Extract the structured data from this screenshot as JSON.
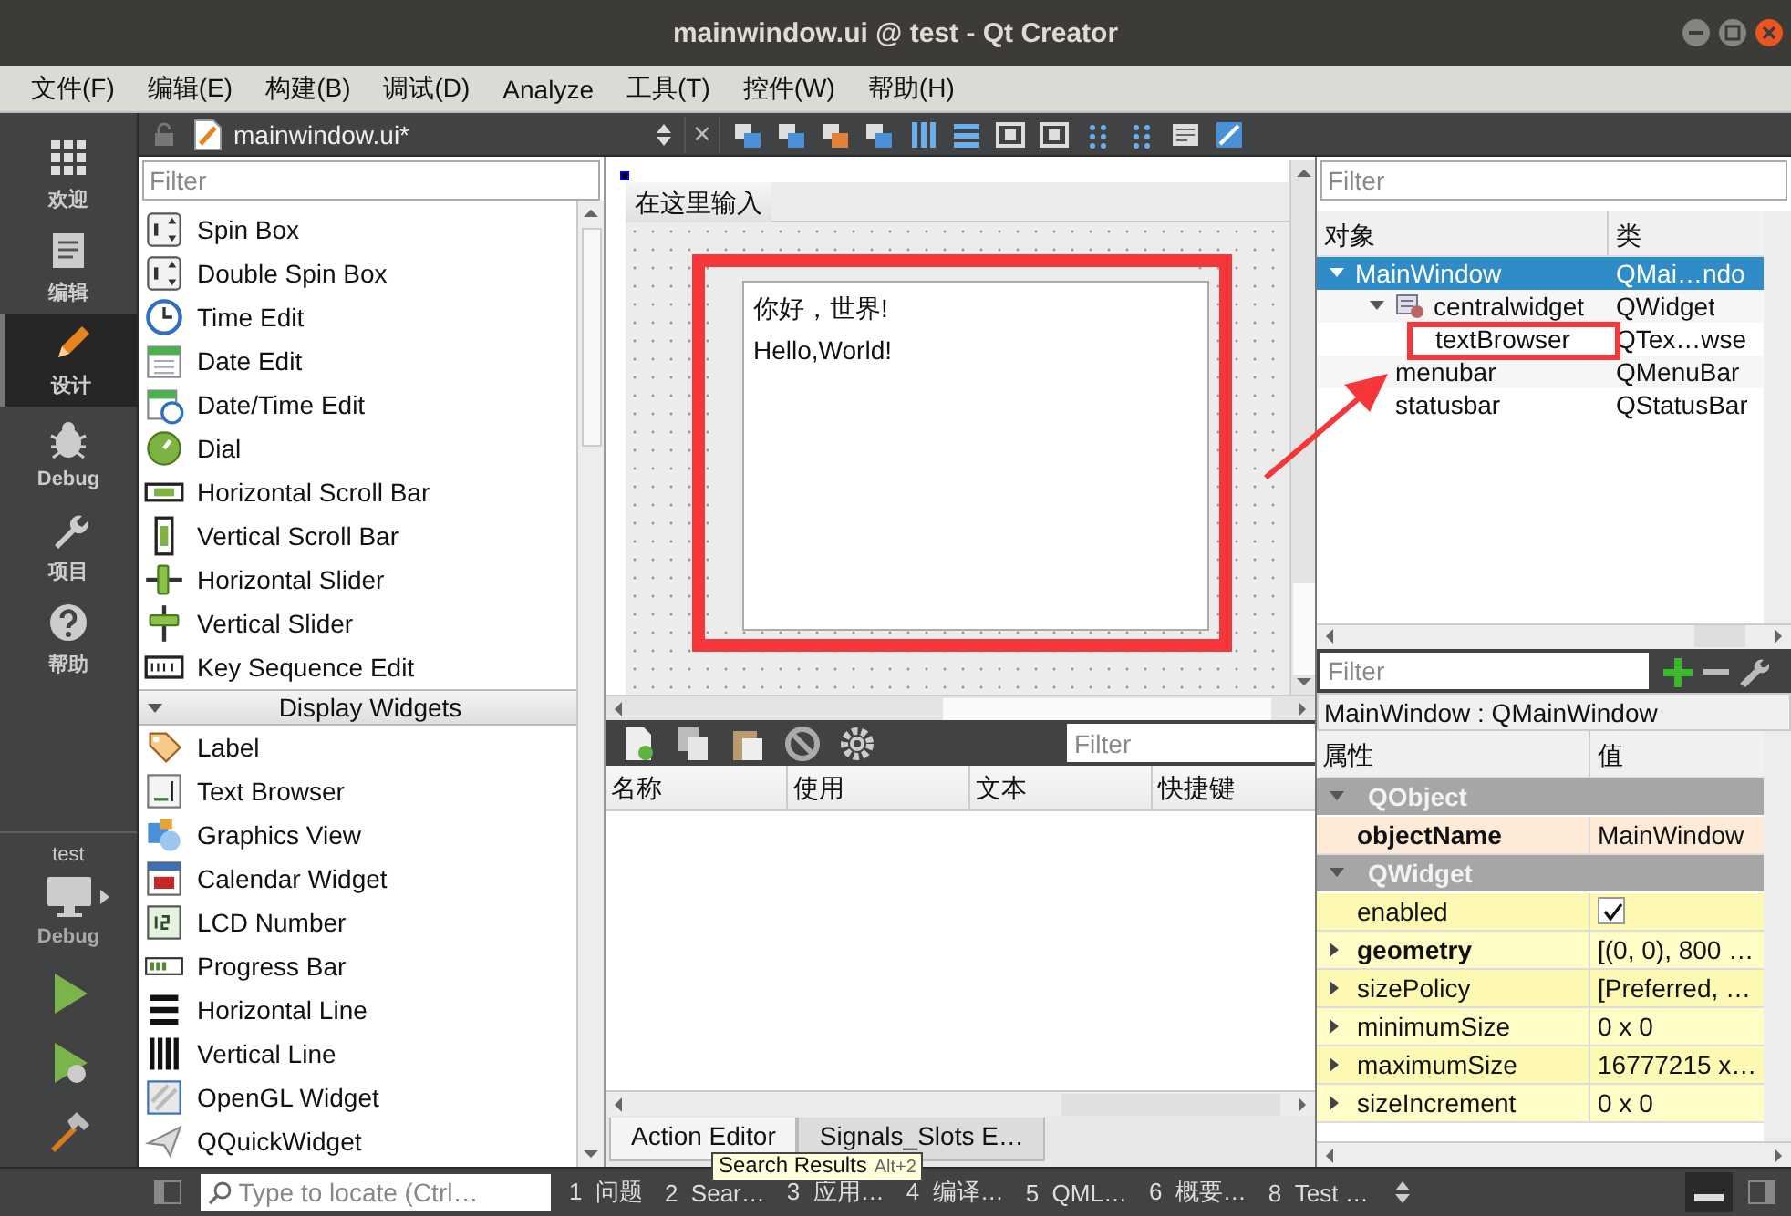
{
  "window": {
    "title": "mainwindow.ui @ test - Qt Creator"
  },
  "menu": [
    "文件(F)",
    "编辑(E)",
    "构建(B)",
    "调试(D)",
    "Analyze",
    "工具(T)",
    "控件(W)",
    "帮助(H)"
  ],
  "mode_bar": {
    "modes": [
      {
        "label": "欢迎",
        "selected": false
      },
      {
        "label": "编辑",
        "selected": false
      },
      {
        "label": "设计",
        "selected": true
      },
      {
        "label": "Debug",
        "selected": false
      },
      {
        "label": "项目",
        "selected": false
      },
      {
        "label": "帮助",
        "selected": false
      }
    ],
    "kit": {
      "project": "test",
      "build": "Debug"
    }
  },
  "editor_toolbar": {
    "file": "mainwindow.ui*",
    "close": "×"
  },
  "widget_box": {
    "filter_placeholder": "Filter",
    "items": [
      {
        "kind": "widget",
        "label": "Spin Box"
      },
      {
        "kind": "widget",
        "label": "Double Spin Box"
      },
      {
        "kind": "widget",
        "label": "Time Edit"
      },
      {
        "kind": "widget",
        "label": "Date Edit"
      },
      {
        "kind": "widget",
        "label": "Date/Time Edit"
      },
      {
        "kind": "widget",
        "label": "Dial"
      },
      {
        "kind": "widget",
        "label": "Horizontal Scroll Bar"
      },
      {
        "kind": "widget",
        "label": "Vertical Scroll Bar"
      },
      {
        "kind": "widget",
        "label": "Horizontal Slider"
      },
      {
        "kind": "widget",
        "label": "Vertical Slider"
      },
      {
        "kind": "widget",
        "label": "Key Sequence Edit"
      },
      {
        "kind": "category",
        "label": "Display Widgets",
        "expanded": true
      },
      {
        "kind": "widget",
        "label": "Label"
      },
      {
        "kind": "widget",
        "label": "Text Browser"
      },
      {
        "kind": "widget",
        "label": "Graphics View"
      },
      {
        "kind": "widget",
        "label": "Calendar Widget"
      },
      {
        "kind": "widget",
        "label": "LCD Number"
      },
      {
        "kind": "widget",
        "label": "Progress Bar"
      },
      {
        "kind": "widget",
        "label": "Horizontal Line"
      },
      {
        "kind": "widget",
        "label": "Vertical Line"
      },
      {
        "kind": "widget",
        "label": "OpenGL Widget"
      },
      {
        "kind": "widget",
        "label": "QQuickWidget"
      }
    ]
  },
  "form": {
    "menu_item": "在这里输入",
    "text_browser": {
      "lines": [
        "你好，世界!",
        "Hello,World!"
      ]
    }
  },
  "action_editor": {
    "filter_placeholder": "Filter",
    "columns": [
      "名称",
      "使用",
      "文本",
      "快捷键"
    ],
    "tabs": [
      {
        "label": "Action Editor",
        "selected": true
      },
      {
        "label": "Signals_Slots E…",
        "selected": false
      }
    ]
  },
  "object_inspector": {
    "filter_placeholder": "Filter",
    "columns": [
      "对象",
      "类"
    ],
    "tree": [
      {
        "name": "MainWindow",
        "class": "QMai…ndo",
        "selected": true,
        "expanded": true,
        "children": [
          {
            "name": "centralwidget",
            "class": "QWidget",
            "selected": false,
            "expanded": true,
            "children": [
              {
                "name": "textBrowser",
                "class": "QTex…wse",
                "selected": false
              }
            ]
          },
          {
            "name": "menubar",
            "class": "QMenuBar",
            "selected": false
          },
          {
            "name": "statusbar",
            "class": "QStatusBar",
            "selected": false
          }
        ]
      }
    ]
  },
  "property_editor": {
    "filter_placeholder": "Filter",
    "object": "MainWindow : QMainWindow",
    "columns": [
      "属性",
      "值"
    ],
    "rows": [
      {
        "kind": "group",
        "name": "QObject",
        "expanded": true
      },
      {
        "kind": "property",
        "name": "objectName",
        "value": "MainWindow",
        "bold": true,
        "expandable": false
      },
      {
        "kind": "group",
        "name": "QWidget",
        "expanded": true
      },
      {
        "kind": "checkbox",
        "name": "enabled",
        "checked": true
      },
      {
        "kind": "property",
        "name": "geometry",
        "value": "[(0, 0), 800 …",
        "bold": true,
        "expandable": true
      },
      {
        "kind": "property",
        "name": "sizePolicy",
        "value": "[Preferred, …",
        "bold": false,
        "expandable": true
      },
      {
        "kind": "property",
        "name": "minimumSize",
        "value": "0 x 0",
        "bold": false,
        "expandable": true
      },
      {
        "kind": "property",
        "name": "maximumSize",
        "value": "16777215 x…",
        "bold": false,
        "expandable": true
      },
      {
        "kind": "property",
        "name": "sizeIncrement",
        "value": "0 x 0",
        "bold": false,
        "expandable": true
      }
    ]
  },
  "tooltip": {
    "text": "Search Results",
    "shortcut": "Alt+2"
  },
  "status_bar": {
    "locator_placeholder": "Type to locate (Ctrl…",
    "panes": [
      {
        "number": "1",
        "label": "问题"
      },
      {
        "number": "2",
        "label": "Sear…"
      },
      {
        "number": "3",
        "label": "应用…"
      },
      {
        "number": "4",
        "label": "编译…"
      },
      {
        "number": "5",
        "label": "QML…"
      },
      {
        "number": "6",
        "label": "概要…"
      },
      {
        "number": "8",
        "label": "Test …"
      }
    ]
  }
}
